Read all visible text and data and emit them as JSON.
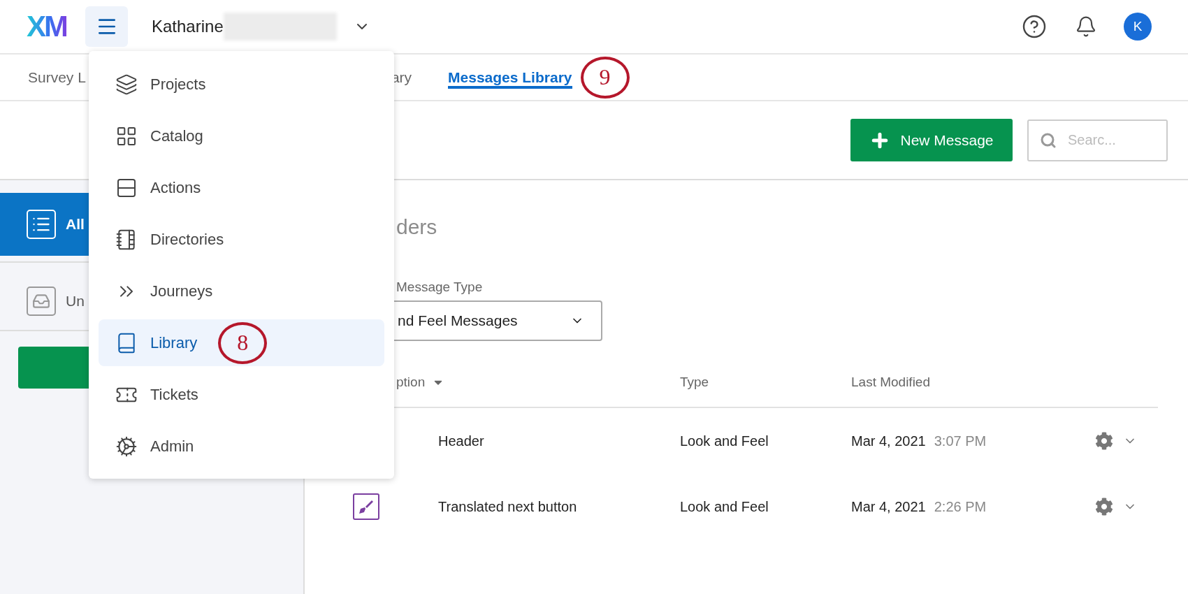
{
  "header": {
    "logo": "XM",
    "account_name": "Katharine",
    "avatar": "K"
  },
  "tabs": [
    {
      "label": "Survey L",
      "selected": false
    },
    {
      "label": "ary",
      "selected": false
    },
    {
      "label": "Messages Library",
      "selected": true,
      "annotation": "9"
    }
  ],
  "toolbar": {
    "new_button": "New Message",
    "search_placeholder": "Searc..."
  },
  "sidebar": {
    "items": [
      {
        "label": "All",
        "selected": true
      },
      {
        "label": "Un",
        "selected": false
      }
    ]
  },
  "main": {
    "heading": "ders",
    "filter_label": "Message Type",
    "filter_value": "nd Feel Messages"
  },
  "table": {
    "columns": [
      "ption",
      "Type",
      "Last Modified"
    ],
    "rows": [
      {
        "description": "Header",
        "type": "Look and Feel",
        "date": "Mar 4, 2021",
        "time": "3:07 PM"
      },
      {
        "description": "Translated next button",
        "type": "Look and Feel",
        "date": "Mar 4, 2021",
        "time": "2:26 PM",
        "show_icon": true
      }
    ]
  },
  "nav_menu": {
    "items": [
      {
        "label": "Projects",
        "selected": false
      },
      {
        "label": "Catalog",
        "selected": false
      },
      {
        "label": "Actions",
        "selected": false
      },
      {
        "label": "Directories",
        "selected": false
      },
      {
        "label": "Journeys",
        "selected": false
      },
      {
        "label": "Library",
        "selected": true,
        "annotation": "8"
      },
      {
        "label": "Tickets",
        "selected": false
      },
      {
        "label": "Admin",
        "selected": false
      }
    ]
  }
}
